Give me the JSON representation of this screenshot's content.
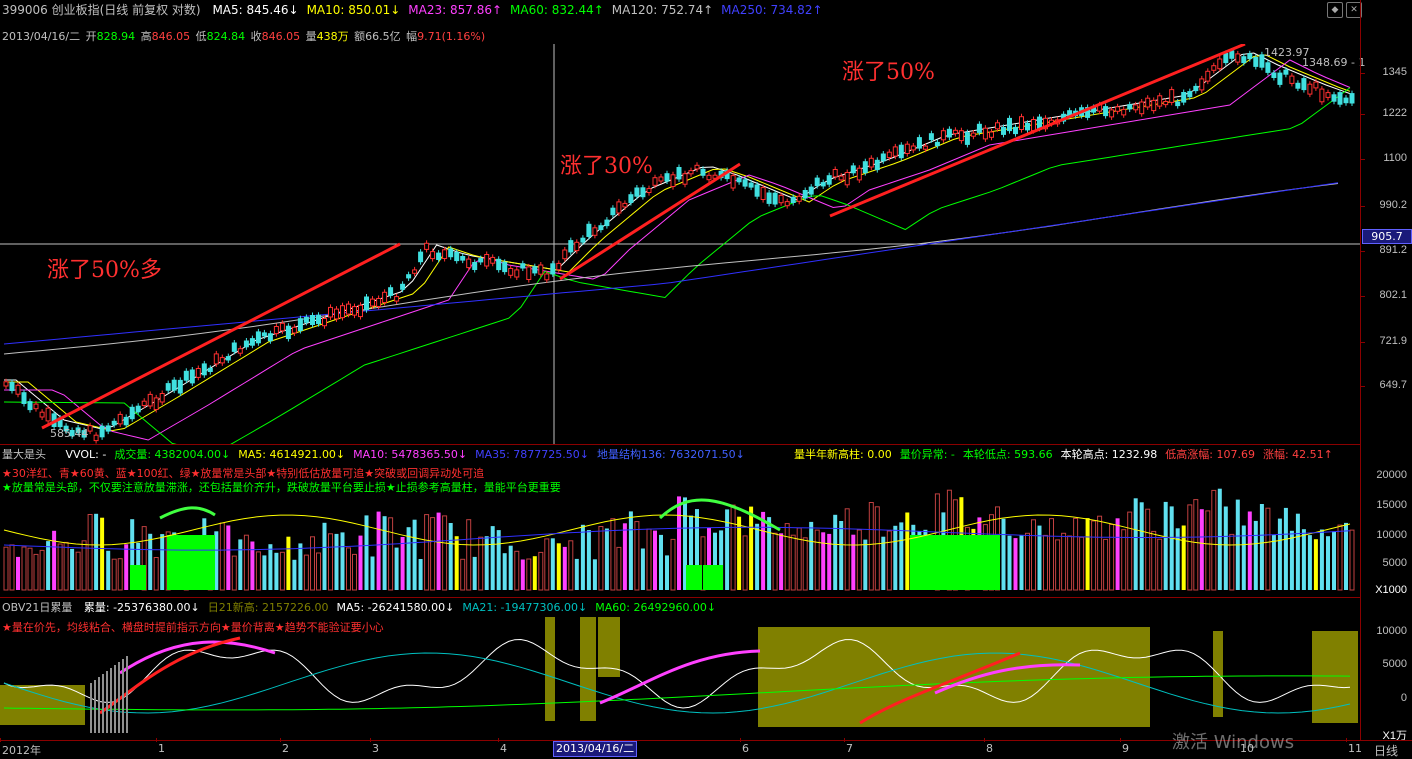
{
  "main_header": {
    "code_name": "399006 创业板指(日线 前复权 对数)",
    "ma": [
      {
        "label": "MA5: 845.46",
        "arrow": "↓",
        "color": "#ffffff"
      },
      {
        "label": "MA10: 850.01",
        "arrow": "↓",
        "color": "#ffff00"
      },
      {
        "label": "MA23: 857.86",
        "arrow": "↑",
        "color": "#ff40ff"
      },
      {
        "label": "MA60: 832.44",
        "arrow": "↑",
        "color": "#00ff00"
      },
      {
        "label": "MA120: 752.74",
        "arrow": "↑",
        "color": "#c0c0c0"
      },
      {
        "label": "MA250: 734.82",
        "arrow": "↑",
        "color": "#4040ff"
      }
    ]
  },
  "info_line": {
    "date": "2013/04/16/二",
    "open_label": "开",
    "open": "828.94",
    "high_label": "高",
    "high": "846.05",
    "low_label": "低",
    "low": "824.84",
    "close_label": "收",
    "close": "846.05",
    "vol_label": "量",
    "vol": "438万",
    "amt_label": "额",
    "amt": "66.5亿",
    "chg_label": "幅",
    "chg": "9.71(1.16%)"
  },
  "annotations": {
    "a1": "涨了50%多",
    "a2": "涨了30%",
    "a3": "涨了50%"
  },
  "price_labels": {
    "high_mark": "1423.97",
    "right_mark": "1348.69 - 1",
    "low_mark": "585.44",
    "crosshair_value": "905.7"
  },
  "price_axis": [
    "1345",
    "1222",
    "1100",
    "990.2",
    "891.2",
    "802.1",
    "721.9",
    "649.7"
  ],
  "volume_header": {
    "name": "量大是头",
    "items": [
      {
        "label": "VVOL: -",
        "color": "#ffffff"
      },
      {
        "label": "成交量: 4382004.00",
        "arrow": "↓",
        "color": "#00ff00"
      },
      {
        "label": "MA5: 4614921.00",
        "arrow": "↓",
        "color": "#ffff00"
      },
      {
        "label": "MA10: 5478365.50",
        "arrow": "↓",
        "color": "#ff40ff"
      },
      {
        "label": "MA35: 7877725.50",
        "arrow": "↓",
        "color": "#4040ff"
      },
      {
        "label": "地量结构136: 7632071.50",
        "arrow": "↓",
        "color": "#4060ff"
      }
    ],
    "right_items": [
      {
        "label": "量半年新高柱: 0.00",
        "color": "#ffff00"
      },
      {
        "label": "量价异常: -",
        "color": "#00ff00"
      },
      {
        "label": "本轮低点: 593.66",
        "color": "#00ff00"
      },
      {
        "label": "本轮高点: 1232.98",
        "color": "#ffffff"
      },
      {
        "label": "低高涨幅: 107.69",
        "color": "#ff4040"
      },
      {
        "label": "涨幅: 42.51",
        "arrow": "↑",
        "color": "#ff4040"
      }
    ],
    "note1": "★30洋红、青★60黄、蓝★100红、绿★放量常是头部★特别低估放量可追★突破或回调异动处可追",
    "note2": "★放量常是头部，不仅要注意放量滞涨，还包括量价齐升，跌破放量平台要止损★止损参考高量柱，量能平台更重要"
  },
  "volume_axis": [
    "20000",
    "15000",
    "10000",
    "5000"
  ],
  "volume_unit": "X1000",
  "obv_header": {
    "name": "OBV21日累量",
    "items": [
      {
        "label": "累量: -25376380.00",
        "arrow": "↓",
        "color": "#ffffff"
      },
      {
        "label": "日21新高: 2157226.00",
        "color": "#808000"
      },
      {
        "label": "MA5: -26241580.00",
        "arrow": "↓",
        "color": "#ffffff"
      },
      {
        "label": "MA21: -19477306.00",
        "arrow": "↓",
        "color": "#00c0c0"
      },
      {
        "label": "MA60: 26492960.00",
        "arrow": "↓",
        "color": "#00ff00"
      }
    ],
    "note": "★量在价先，均线粘合、横盘时提前指示方向★量价背离★趋势不能验证要小心"
  },
  "obv_axis": [
    "10000",
    "5000",
    "0"
  ],
  "obv_unit": "X1万",
  "x_axis": {
    "labels": [
      "2012年",
      "1",
      "2",
      "3",
      "4",
      "5",
      "6",
      "7",
      "8",
      "9",
      "10",
      "11"
    ],
    "cursor_date": "2013/04/16/二",
    "period": "日线"
  },
  "watermark": "激活 Windows",
  "chart_data": {
    "type": "candlestick",
    "title": "399006 创业板指(日线 前复权 对数)",
    "ylim": [
      585.44,
      1423.97
    ],
    "series": [
      {
        "name": "MA5",
        "values": [
          845.46
        ]
      },
      {
        "name": "MA10",
        "values": [
          850.01
        ]
      },
      {
        "name": "MA23",
        "values": [
          857.86
        ]
      },
      {
        "name": "MA60",
        "values": [
          832.44
        ]
      },
      {
        "name": "MA120",
        "values": [
          752.74
        ]
      },
      {
        "name": "MA250",
        "values": [
          734.82
        ]
      }
    ],
    "selected_bar": {
      "date": "2013/04/16",
      "open": 828.94,
      "high": 846.05,
      "low": 824.84,
      "close": 846.05
    }
  }
}
